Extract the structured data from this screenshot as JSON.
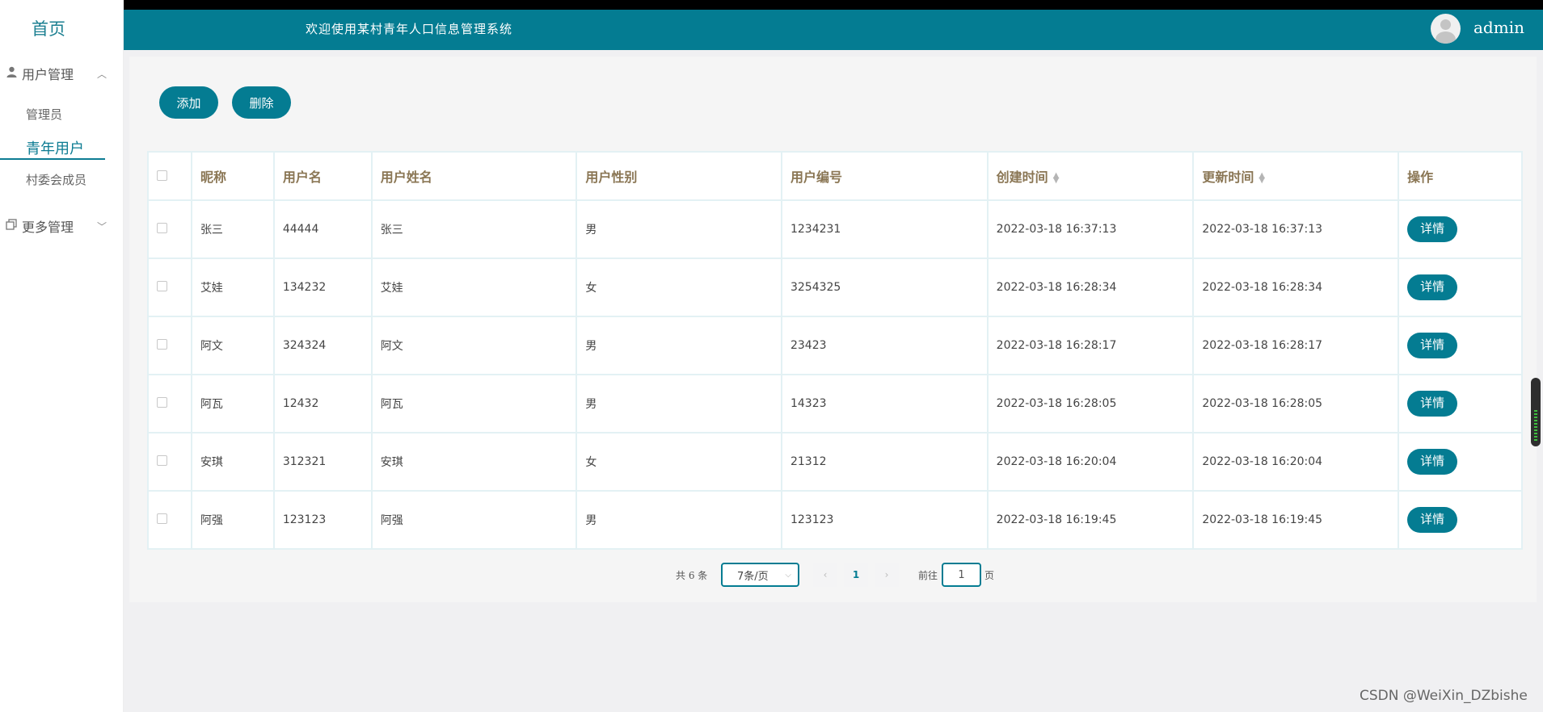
{
  "sidebar": {
    "home": "首页",
    "groups": [
      {
        "label": "用户管理",
        "icon": "user-icon",
        "expanded": true,
        "items": [
          "管理员",
          "青年用户",
          "村委会成员"
        ]
      },
      {
        "label": "更多管理",
        "icon": "copy-icon",
        "expanded": false,
        "items": []
      }
    ],
    "active_item": "青年用户"
  },
  "header": {
    "title": "欢迎使用某村青年人口信息管理系统",
    "user": "admin"
  },
  "toolbar": {
    "add_label": "添加",
    "delete_label": "删除"
  },
  "table": {
    "columns": [
      "昵称",
      "用户名",
      "用户姓名",
      "用户性别",
      "用户编号",
      "创建时间",
      "更新时间",
      "操作"
    ],
    "rows": [
      {
        "nickname": "张三",
        "username": "44444",
        "realname": "张三",
        "gender": "男",
        "code": "1234231",
        "created": "2022-03-18 16:37:13",
        "updated": "2022-03-18 16:37:13"
      },
      {
        "nickname": "艾娃",
        "username": "134232",
        "realname": "艾娃",
        "gender": "女",
        "code": "3254325",
        "created": "2022-03-18 16:28:34",
        "updated": "2022-03-18 16:28:34"
      },
      {
        "nickname": "阿文",
        "username": "324324",
        "realname": "阿文",
        "gender": "男",
        "code": "23423",
        "created": "2022-03-18 16:28:17",
        "updated": "2022-03-18 16:28:17"
      },
      {
        "nickname": "阿瓦",
        "username": "12432",
        "realname": "阿瓦",
        "gender": "男",
        "code": "14323",
        "created": "2022-03-18 16:28:05",
        "updated": "2022-03-18 16:28:05"
      },
      {
        "nickname": "安琪",
        "username": "312321",
        "realname": "安琪",
        "gender": "女",
        "code": "21312",
        "created": "2022-03-18 16:20:04",
        "updated": "2022-03-18 16:20:04"
      },
      {
        "nickname": "阿强",
        "username": "123123",
        "realname": "阿强",
        "gender": "男",
        "code": "123123",
        "created": "2022-03-18 16:19:45",
        "updated": "2022-03-18 16:19:45"
      }
    ],
    "detail_label": "详情"
  },
  "pagination": {
    "total_text": "共 6 条",
    "page_size": "7条/页",
    "current_page": "1",
    "goto_label": "前往",
    "goto_value": "1",
    "page_unit": "页"
  },
  "watermark": "CSDN @WeiXin_DZbishe",
  "colors": {
    "primary": "#047c92",
    "header_text": "#8a7654"
  }
}
